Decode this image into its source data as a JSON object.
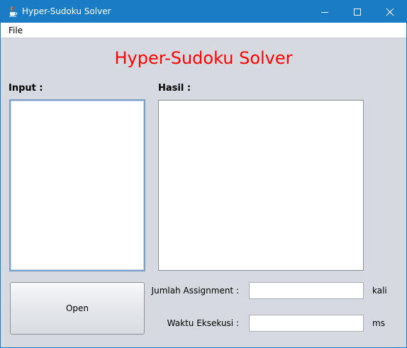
{
  "window": {
    "title": "Hyper-Sudoku Solver",
    "icon": "java-cup-icon",
    "controls": [
      "minimize-icon",
      "maximize-icon",
      "close-icon"
    ],
    "titlebar_color": "#1a7cc4"
  },
  "menu": {
    "file_label": "File"
  },
  "main": {
    "heading": "Hyper-Sudoku Solver",
    "heading_color": "#ff0000",
    "input_label": "Input :",
    "input_value": "",
    "output_label": "Hasil :",
    "output_value": "",
    "open_button_label": "Open",
    "assignment_label": "Jumlah Assignment :",
    "assignment_value": "",
    "assignment_unit": "kali",
    "time_label": "Waktu Eksekusi :",
    "time_value": "",
    "time_unit": "ms"
  }
}
